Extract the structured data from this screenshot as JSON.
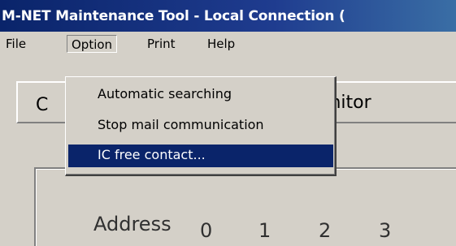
{
  "window": {
    "title": "M-NET Maintenance Tool - Local Connection ("
  },
  "menubar": {
    "items": [
      {
        "label": "File"
      },
      {
        "label": "Option"
      },
      {
        "label": "Print"
      },
      {
        "label": "Help"
      }
    ]
  },
  "dropdown": {
    "items": [
      {
        "label": "Automatic searching"
      },
      {
        "label": "Stop mail communication"
      },
      {
        "label": "IC free contact..."
      }
    ],
    "selected_index": 2
  },
  "toolbar": {
    "first_button_label": "C",
    "monitor_label": "onitor"
  },
  "panel": {
    "address_label": "Address",
    "address_numbers": [
      "0",
      "1",
      "2",
      "3"
    ]
  },
  "colors": {
    "title_bar": "#0a246a",
    "selection": "#0a246a",
    "face": "#d4d0c8"
  }
}
